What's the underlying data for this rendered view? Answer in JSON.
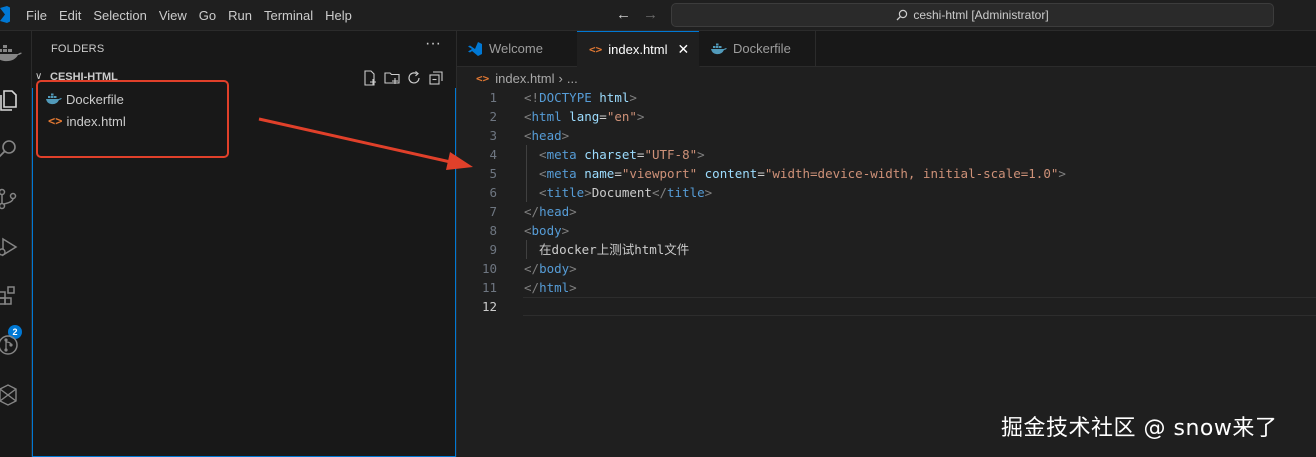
{
  "menu": [
    "File",
    "Edit",
    "Selection",
    "View",
    "Go",
    "Run",
    "Terminal",
    "Help"
  ],
  "command_center": {
    "text": "ceshi-html [Administrator]"
  },
  "activity_bar": {
    "extensions_badge": "2"
  },
  "sidebar": {
    "title": "FOLDERS",
    "more": "···",
    "folder_name": "CESHI-HTML",
    "files": [
      {
        "name": "Dockerfile",
        "icon": "docker-icon"
      },
      {
        "name": "index.html",
        "icon": "html-icon"
      }
    ]
  },
  "tabs": [
    {
      "label": "Welcome",
      "icon": "vscode-icon",
      "active": false
    },
    {
      "label": "index.html",
      "icon": "html-icon",
      "active": true
    },
    {
      "label": "Dockerfile",
      "icon": "docker-icon",
      "active": false
    }
  ],
  "breadcrumb": {
    "file": "index.html",
    "sep": "›",
    "more": "..."
  },
  "editor": {
    "current_line": 12,
    "lines": [
      [
        {
          "t": "<!",
          "c": "bracket"
        },
        {
          "t": "DOCTYPE",
          "c": "tag"
        },
        {
          "t": " ",
          "c": "text"
        },
        {
          "t": "html",
          "c": "attr"
        },
        {
          "t": ">",
          "c": "bracket"
        }
      ],
      [
        {
          "t": "<",
          "c": "bracket"
        },
        {
          "t": "html",
          "c": "tag"
        },
        {
          "t": " ",
          "c": "text"
        },
        {
          "t": "lang",
          "c": "attr"
        },
        {
          "t": "=",
          "c": "text"
        },
        {
          "t": "\"en\"",
          "c": "str"
        },
        {
          "t": ">",
          "c": "bracket"
        }
      ],
      [
        {
          "t": "<",
          "c": "bracket"
        },
        {
          "t": "head",
          "c": "tag"
        },
        {
          "t": ">",
          "c": "bracket"
        }
      ],
      [
        {
          "t": "  <",
          "c": "bracket"
        },
        {
          "t": "meta",
          "c": "tag"
        },
        {
          "t": " ",
          "c": "text"
        },
        {
          "t": "charset",
          "c": "attr"
        },
        {
          "t": "=",
          "c": "text"
        },
        {
          "t": "\"UTF-8\"",
          "c": "str"
        },
        {
          "t": ">",
          "c": "bracket"
        }
      ],
      [
        {
          "t": "  <",
          "c": "bracket"
        },
        {
          "t": "meta",
          "c": "tag"
        },
        {
          "t": " ",
          "c": "text"
        },
        {
          "t": "name",
          "c": "attr"
        },
        {
          "t": "=",
          "c": "text"
        },
        {
          "t": "\"viewport\"",
          "c": "str"
        },
        {
          "t": " ",
          "c": "text"
        },
        {
          "t": "content",
          "c": "attr"
        },
        {
          "t": "=",
          "c": "text"
        },
        {
          "t": "\"width=device-width, initial-scale=1.0\"",
          "c": "str"
        },
        {
          "t": ">",
          "c": "bracket"
        }
      ],
      [
        {
          "t": "  <",
          "c": "bracket"
        },
        {
          "t": "title",
          "c": "tag"
        },
        {
          "t": ">",
          "c": "bracket"
        },
        {
          "t": "Document",
          "c": "text"
        },
        {
          "t": "</",
          "c": "bracket"
        },
        {
          "t": "title",
          "c": "tag"
        },
        {
          "t": ">",
          "c": "bracket"
        }
      ],
      [
        {
          "t": "</",
          "c": "bracket"
        },
        {
          "t": "head",
          "c": "tag"
        },
        {
          "t": ">",
          "c": "bracket"
        }
      ],
      [
        {
          "t": "<",
          "c": "bracket"
        },
        {
          "t": "body",
          "c": "tag"
        },
        {
          "t": ">",
          "c": "bracket"
        }
      ],
      [
        {
          "t": "  在docker上测试html文件",
          "c": "text"
        }
      ],
      [
        {
          "t": "</",
          "c": "bracket"
        },
        {
          "t": "body",
          "c": "tag"
        },
        {
          "t": ">",
          "c": "bracket"
        }
      ],
      [
        {
          "t": "</",
          "c": "bracket"
        },
        {
          "t": "html",
          "c": "tag"
        },
        {
          "t": ">",
          "c": "bracket"
        }
      ],
      []
    ]
  },
  "watermark": "掘金技术社区 @ snow来了",
  "colors": {
    "accent": "#0078d4",
    "annotation": "#e0402a",
    "html_icon": "#e37933",
    "docker_icon": "#519aba"
  }
}
